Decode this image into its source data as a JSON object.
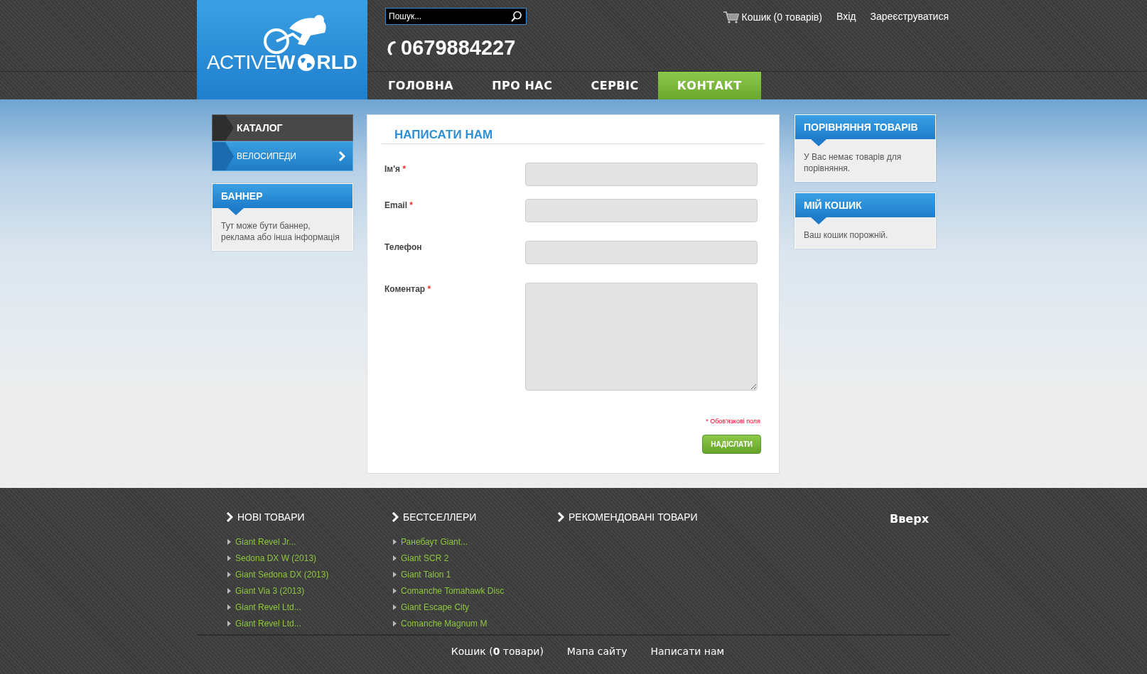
{
  "header": {
    "logo": {
      "light": "ACTIVE",
      "bold_start": "W",
      "bold_end": "RLD"
    },
    "search": {
      "placeholder": "Пошук..."
    },
    "phone": "0679884227",
    "top_links": [
      {
        "kind": "cart",
        "label": "Кошик (0 товарів)"
      },
      {
        "kind": "link",
        "label": "Вхід"
      },
      {
        "kind": "link",
        "label": "Зареєструватися"
      }
    ]
  },
  "nav": [
    {
      "label": "ГОЛОВНА",
      "selected": false
    },
    {
      "label": "ПРО НАС",
      "selected": false
    },
    {
      "label": "СЕРВІС",
      "selected": false
    },
    {
      "label": "КОНТАКТ",
      "selected": true
    }
  ],
  "left_sidebar": {
    "catalog": {
      "title": "КАТАЛОГ",
      "items": [
        "ВЕЛОСИПЕДИ"
      ]
    },
    "banner": {
      "title": "БАННЕР",
      "text": "Тут може бути баннер, реклама або інша інформація"
    }
  },
  "form": {
    "title": "НАПИСАТИ НАМ",
    "fields": [
      {
        "kind": "input",
        "label": "Ім'я",
        "required_mark": "*"
      },
      {
        "kind": "input",
        "label": "Email",
        "required_mark": "*"
      },
      {
        "kind": "input",
        "label": "Телефон"
      },
      {
        "kind": "textarea",
        "label": "Коментар",
        "required_mark": "*"
      }
    ],
    "required_note": "* Обов'язкові поля",
    "submit": "НАДІСЛАТИ"
  },
  "right_sidebar": [
    {
      "title": "ПОРІВНЯННЯ ТОВАРІВ",
      "text": "У Вас немає товарів для порівняння."
    },
    {
      "title": "МІЙ КОШИК",
      "text": "Ваш кошик порожній."
    }
  ],
  "footer": {
    "columns": [
      {
        "title": "НОВІ ТОВАРИ",
        "items": [
          "Giant Revel Jr...",
          "Sedona DX W (2013)",
          "Giant Sedona DX (2013)",
          "Giant Via 3 (2013)",
          "Giant Revel Ltd...",
          "Giant Revel Ltd..."
        ]
      },
      {
        "title": "БЕСТСЕЛЛЕРИ",
        "items": [
          "Ранебаут Giant...",
          "Giant SCR 2",
          "Giant Talon 1",
          "Comanche Tomahawk Disc",
          "Giant Escape City",
          "Comanche Magnum M"
        ]
      },
      {
        "title": "РЕКОМЕНДОВАНІ ТОВАРИ"
      }
    ],
    "top_link": "Вверх",
    "bottom_links": [
      "Кошик (**0** товари)",
      "Мапа сайту",
      "Написати нам"
    ]
  }
}
